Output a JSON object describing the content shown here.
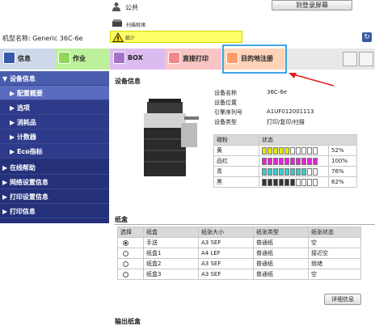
{
  "header": {
    "user_label": "公共",
    "login_button": "到登录屏幕",
    "scan_status": "扫描就绪",
    "warning_text": "纸少",
    "model": "机型名称: Generic 36C-6e"
  },
  "tabs": [
    {
      "label": "信息",
      "color": "#3558a8"
    },
    {
      "label": "作业",
      "color": "#8fd65a"
    },
    {
      "label": "BOX",
      "color": "#a472c8"
    },
    {
      "label": "直接打印",
      "color": "#f08a8a"
    },
    {
      "label": "目的地注册",
      "color": "#ff9b66"
    }
  ],
  "sidebar": {
    "items": [
      {
        "label": "▼ 设备信息"
      },
      {
        "label": "▶ 配置概要"
      },
      {
        "label": "▶ 选项"
      },
      {
        "label": "▶ 消耗品"
      },
      {
        "label": "▶ 计数器"
      },
      {
        "label": "▶ Eco指标"
      },
      {
        "label": "▶ 在线帮助"
      },
      {
        "label": "▶ 网络设置信息"
      },
      {
        "label": "▶ 打印设置信息"
      },
      {
        "label": "▶ 打印信息"
      }
    ]
  },
  "device_info": {
    "title": "设备信息",
    "rows": [
      {
        "label": "设备名称",
        "value": "36C-6e"
      },
      {
        "label": "设备位置",
        "value": ""
      },
      {
        "label": "引擎序列号",
        "value": "A1UF012001113"
      },
      {
        "label": "设备类型",
        "value": "打印/复印/扫描"
      }
    ]
  },
  "toner": {
    "headers": [
      "碳粉",
      "状态"
    ],
    "rows": [
      {
        "name": "黄",
        "level": 0.52,
        "color": "#e8e800",
        "percent": "52%"
      },
      {
        "name": "品红",
        "level": 1.0,
        "color": "#e820d8",
        "percent": "100%"
      },
      {
        "name": "青",
        "level": 0.76,
        "color": "#3ccccc",
        "percent": "76%"
      },
      {
        "name": "黑",
        "level": 0.62,
        "color": "#333333",
        "percent": "62%"
      }
    ]
  },
  "paper": {
    "title": "纸盒",
    "headers": [
      "选择",
      "纸盒",
      "纸张大小",
      "纸张类型",
      "纸张状态"
    ],
    "rows": [
      {
        "selected": true,
        "tray": "手送",
        "size": "A3 SEF",
        "type": "普通纸",
        "status": "空"
      },
      {
        "selected": false,
        "tray": "纸盒1",
        "size": "A4 LEF",
        "type": "普通纸",
        "status": "接近空"
      },
      {
        "selected": false,
        "tray": "纸盒2",
        "size": "A3 SEF",
        "type": "普通纸",
        "status": "就绪"
      },
      {
        "selected": false,
        "tray": "纸盒3",
        "size": "A3 SEF",
        "type": "普通纸",
        "status": "空"
      }
    ],
    "detail_button": "详细信息"
  },
  "output": {
    "title": "输出纸盒"
  }
}
